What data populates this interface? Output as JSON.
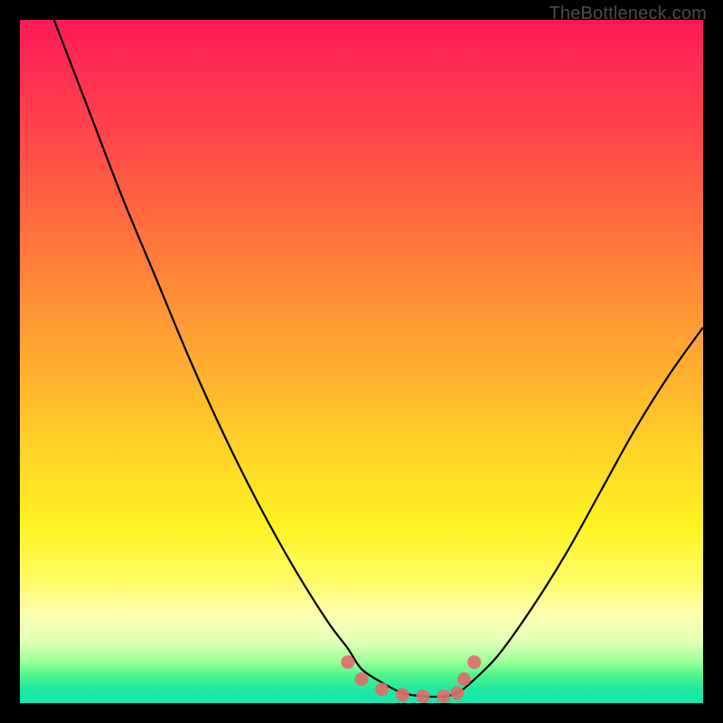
{
  "watermark": "TheBottleneck.com",
  "colors": {
    "frame": "#000000",
    "curve": "#000000",
    "marker": "#e06d6b",
    "gradient_top": "#ff1a57",
    "gradient_bottom": "#13e6ae"
  },
  "chart_data": {
    "type": "line",
    "title": "",
    "xlabel": "",
    "ylabel": "",
    "xlim": [
      0,
      100
    ],
    "ylim": [
      0,
      100
    ],
    "series": [
      {
        "name": "curve",
        "x": [
          5,
          10,
          15,
          20,
          25,
          30,
          35,
          40,
          45,
          48,
          50,
          53,
          56,
          59,
          62,
          64,
          66,
          70,
          75,
          80,
          85,
          90,
          95,
          100
        ],
        "y": [
          100,
          87,
          74,
          62,
          50,
          39,
          29,
          20,
          12,
          8,
          5,
          3,
          1.5,
          1,
          1,
          1.5,
          3,
          7,
          14,
          22,
          31,
          40,
          48,
          55
        ]
      }
    ],
    "markers": {
      "name": "highlighted-points",
      "color": "#e06d6b",
      "x": [
        48,
        50,
        53,
        56,
        59,
        62,
        64,
        65,
        66.5
      ],
      "y": [
        6,
        3.5,
        2,
        1.2,
        1,
        1,
        1.5,
        3.5,
        6
      ]
    }
  }
}
